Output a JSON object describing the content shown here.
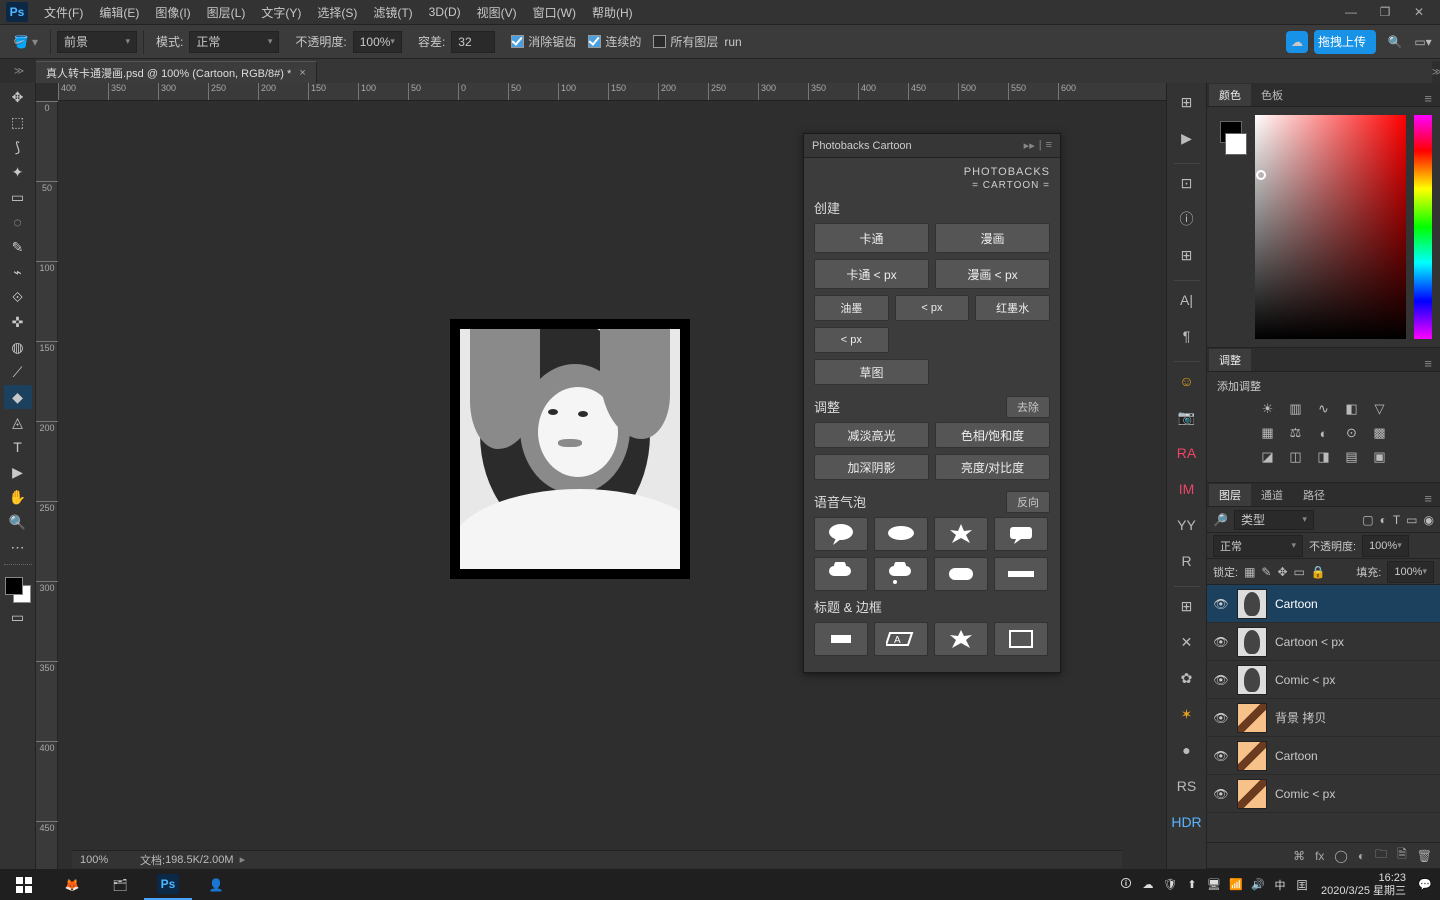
{
  "menu": {
    "items": [
      "文件(F)",
      "编辑(E)",
      "图像(I)",
      "图层(L)",
      "文字(Y)",
      "选择(S)",
      "滤镜(T)",
      "3D(D)",
      "视图(V)",
      "窗口(W)",
      "帮助(H)"
    ]
  },
  "window_controls": {
    "min": "—",
    "max": "❐",
    "close": "✕"
  },
  "logo": "Ps",
  "optbar": {
    "fill_target": {
      "label": "前景"
    },
    "mode_label": "模式:",
    "mode_value": "正常",
    "opacity_label": "不透明度:",
    "opacity_value": "100%",
    "tolerance_label": "容差:",
    "tolerance_value": "32",
    "cb1": {
      "state": "on",
      "label": "消除锯齿"
    },
    "cb2": {
      "state": "on",
      "label": "连续的"
    },
    "cb3": {
      "state": "off",
      "label": "所有图层"
    },
    "upload_label": "拖拽上传"
  },
  "doc_tab": "真人转卡通漫画.psd @ 100% (Cartoon, RGB/8#) *",
  "tool_icons": [
    "✥",
    "⬚",
    "⟆",
    "✦",
    "▭",
    "◌",
    "✎",
    "⌁",
    "⟐",
    "✜",
    "◍",
    "⟋",
    "◆",
    "◬",
    "T",
    "▶",
    "✋",
    "🔍",
    "⋯",
    "▭"
  ],
  "tool_active_index": 12,
  "ruler_h": [
    "400",
    "350",
    "300",
    "250",
    "200",
    "150",
    "100",
    "50",
    "0",
    "50",
    "100",
    "150",
    "200",
    "250",
    "300",
    "350",
    "400",
    "450",
    "500",
    "550",
    "600"
  ],
  "ruler_v": [
    "0",
    "50",
    "100",
    "150",
    "200",
    "250",
    "300",
    "350",
    "400",
    "450"
  ],
  "ruler_v_sub": [
    "2\n0\n0",
    "1\n5\n0",
    "1\n0\n0",
    "5\n0",
    "0",
    "5\n0",
    "1\n0\n0",
    "1\n5\n0",
    "2\n0\n0"
  ],
  "pb": {
    "tab": "Photobacks Cartoon",
    "logo_l1": "PHOTOBACKS",
    "logo_l2": "= CARTOON =",
    "h_create": "创建",
    "b_cartoon": "卡通",
    "b_comic": "漫画",
    "b_cartoon_px": "卡通 < px",
    "b_comic_px": "漫画 < px",
    "b_ink": "油墨",
    "b_px": "< px",
    "b_redink": "红墨水",
    "b_px2": "< px",
    "b_sketch": "草图",
    "h_adjust": "调整",
    "b_remove": "去除",
    "b_lighten": "减淡高光",
    "b_huesat": "色相/饱和度",
    "b_darken": "加深阴影",
    "b_brightness": "亮度/对比度",
    "h_bubble": "语音气泡",
    "b_invert": "反向",
    "h_title": "标题 & 边框"
  },
  "strip": [
    "⊞",
    "▶",
    "⊡",
    "ⓘ",
    "⊞",
    "A|",
    "¶",
    "☺",
    "📷",
    "RA",
    "IM",
    "YY",
    "R",
    "⊞",
    "✕",
    "✿",
    "✶",
    "●",
    "RS",
    "HDR"
  ],
  "panels": {
    "color": {
      "tab1": "颜色",
      "tab2": "色板"
    },
    "adjust": {
      "tab": "调整",
      "title": "添加调整"
    },
    "layers": {
      "tab1": "图层",
      "tab2": "通道",
      "tab3": "路径",
      "filter": "类型",
      "blend": "正常",
      "opacity_l": "不透明度:",
      "opacity_v": "100%",
      "lock_l": "锁定:",
      "fill_l": "填充:",
      "fill_v": "100%",
      "items": [
        {
          "name": "Cartoon",
          "sel": true,
          "bw": true
        },
        {
          "name": "Cartoon < px",
          "bw": true
        },
        {
          "name": "Comic < px",
          "bw": true
        },
        {
          "name": "背景 拷贝",
          "bw": false
        },
        {
          "name": "Cartoon",
          "bw": false
        },
        {
          "name": "Comic < px",
          "bw": false
        }
      ]
    }
  },
  "doc_status": {
    "zoom": "100%",
    "label": "文档:",
    "value": "198.5K/2.00M"
  },
  "taskbar": {
    "ime": "中",
    "ime2": "囯",
    "time": "16:23",
    "date": "2020/3/25 星期三"
  }
}
